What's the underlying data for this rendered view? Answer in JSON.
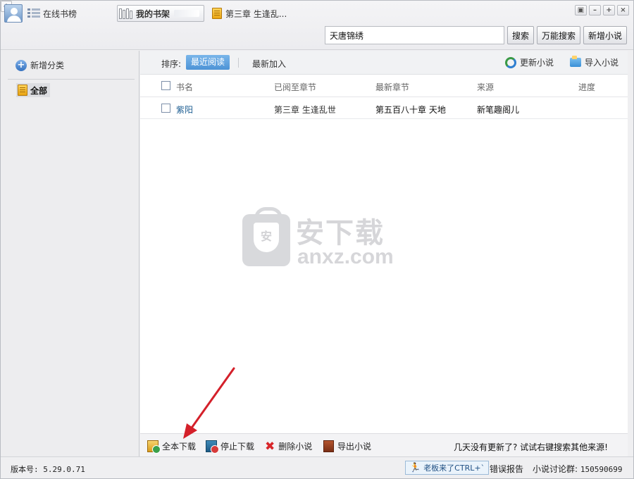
{
  "tabs": {
    "online": "在线书榜",
    "shelf": "我的书架",
    "chapter": "第三章 生逢乱...",
    "add": "+"
  },
  "window_controls": [
    "▣",
    "–",
    "+",
    "×"
  ],
  "search": {
    "value": "天唐锦绣",
    "search_btn": "搜索",
    "universal_btn": "万能搜索",
    "add_novel_btn": "新增小说"
  },
  "sidebar": {
    "add_category": "新增分类",
    "all": "全部"
  },
  "sortbar": {
    "label": "排序:",
    "recent_read": "最近阅读",
    "recent_added": "最新加入",
    "update": "更新小说",
    "import": "导入小说"
  },
  "table": {
    "headers": [
      "书名",
      "已阅至章节",
      "最新章节",
      "来源",
      "进度"
    ],
    "rows": [
      {
        "name": "紫阳",
        "read": "第三章 生逢乱世",
        "latest": "第五百八十章  天地",
        "source": "新笔趣阁儿",
        "progress": ""
      }
    ]
  },
  "watermark": {
    "cn": "安下载",
    "en": "anxz.com",
    "shield": "安"
  },
  "bottom": {
    "full_download": "全本下载",
    "stop_download": "停止下载",
    "delete": "删除小说",
    "export": "导出小说",
    "tip": "几天没有更新了? 试试右键搜索其他来源!"
  },
  "status": {
    "version": "版本号: 5.29.0.71",
    "boss": "老板来了CTRL+`",
    "report": "错误报告",
    "group_label": "小说讨论群:",
    "group_number": "150590699"
  }
}
